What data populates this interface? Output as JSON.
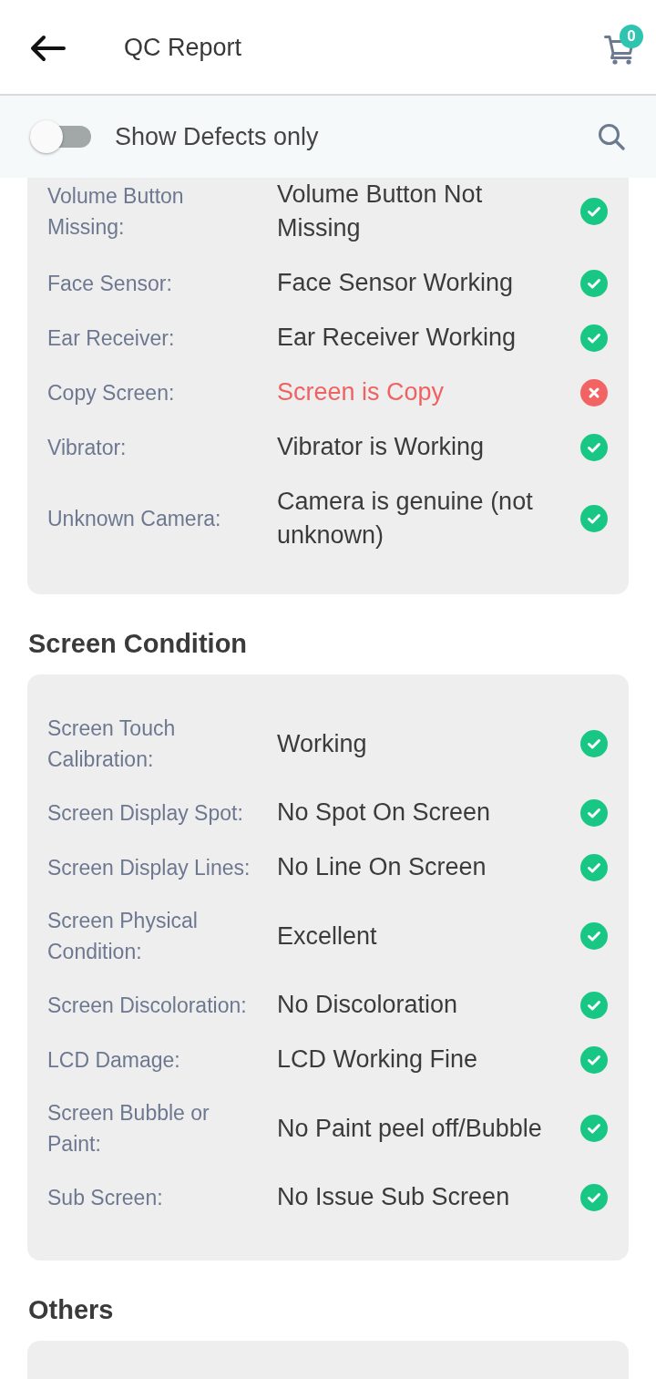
{
  "header": {
    "title": "QC Report",
    "cart_badge": "0"
  },
  "filter_bar": {
    "toggle": {
      "label": "Show Defects only",
      "on": false
    }
  },
  "sections": [
    {
      "items": [
        {
          "label": "Volume Button Missing:",
          "value": "Volume Button Not Missing",
          "passed": true
        },
        {
          "label": "Face Sensor:",
          "value": "Face Sensor Working",
          "passed": true
        },
        {
          "label": "Ear Receiver:",
          "value": "Ear Receiver Working",
          "passed": true
        },
        {
          "label": "Copy Screen:",
          "value": "Screen is Copy",
          "passed": false
        },
        {
          "label": "Vibrator:",
          "value": "Vibrator is Working",
          "passed": true
        },
        {
          "label": "Unknown Camera:",
          "value": "Camera is genuine (not unknown)",
          "passed": true
        }
      ]
    },
    {
      "title": "Screen Condition",
      "items": [
        {
          "label": "Screen Touch Calibration:",
          "value": "Working",
          "passed": true
        },
        {
          "label": "Screen Display Spot:",
          "value": "No Spot On Screen",
          "passed": true
        },
        {
          "label": "Screen Display Lines:",
          "value": "No Line On Screen",
          "passed": true
        },
        {
          "label": "Screen Physical Condition:",
          "value": "Excellent",
          "passed": true
        },
        {
          "label": "Screen Discoloration:",
          "value": "No Discoloration",
          "passed": true
        },
        {
          "label": "LCD Damage:",
          "value": "LCD Working Fine",
          "passed": true
        },
        {
          "label": "Screen Bubble or Paint:",
          "value": "No Paint peel off/Bubble",
          "passed": true
        },
        {
          "label": "Sub Screen:",
          "value": "No Issue Sub Screen",
          "passed": true
        }
      ]
    },
    {
      "title": "Others"
    }
  ]
}
